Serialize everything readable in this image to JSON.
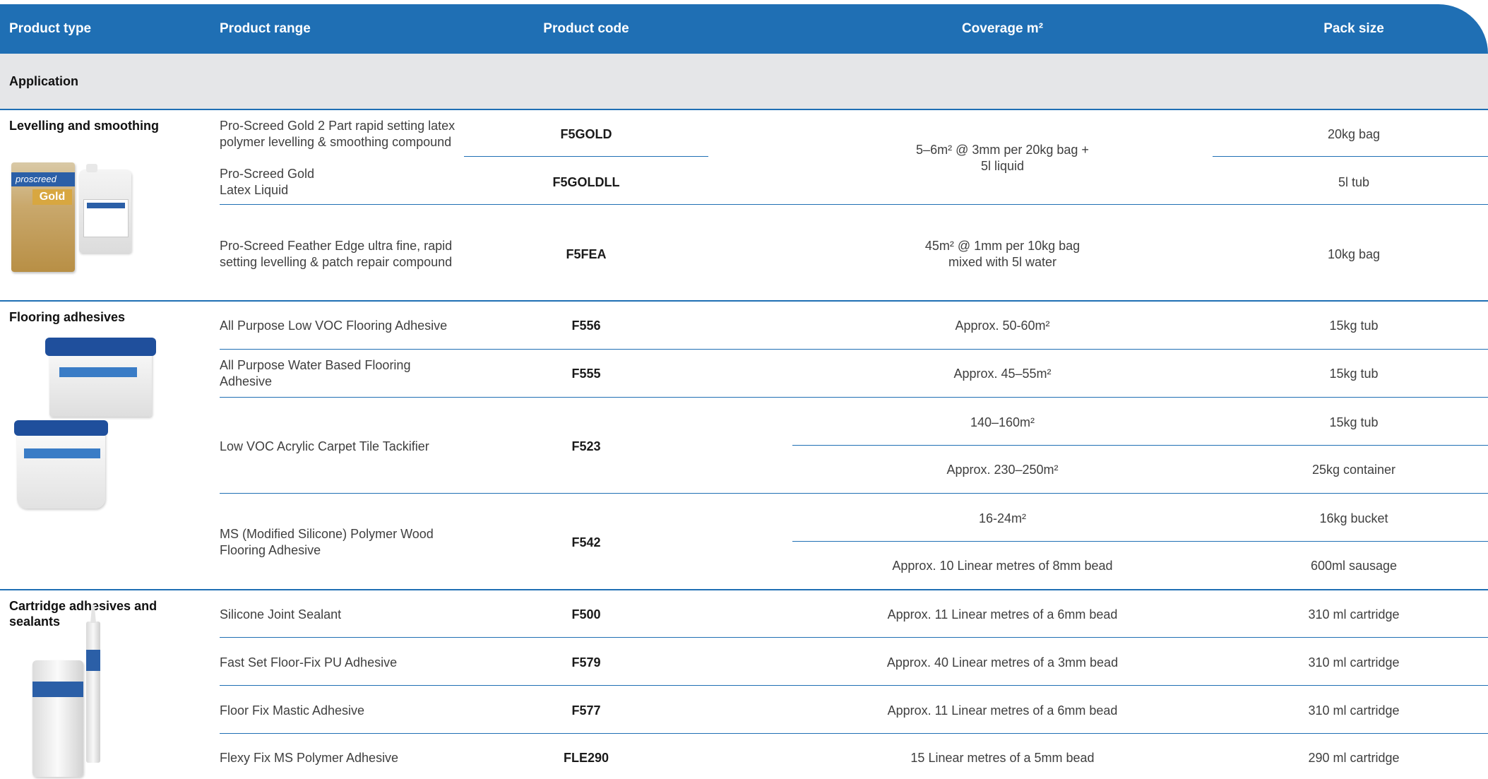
{
  "header": {
    "product_type": "Product type",
    "product_range": "Product range",
    "product_code": "Product code",
    "coverage": "Coverage m²",
    "pack_size": "Pack size"
  },
  "application_label": "Application",
  "groups": [
    {
      "title": "Levelling and smoothing",
      "rows": [
        {
          "range": "Pro-Screed Gold 2 Part rapid setting latex polymer levelling & smoothing compound",
          "code": "F5GOLD",
          "pack": "20kg bag"
        },
        {
          "range": "Pro-Screed Gold Latex Liquid",
          "code": "F5GOLDLL",
          "pack": "5l tub"
        },
        {
          "range": "Pro-Screed Feather Edge ultra fine, rapid setting levelling & patch repair compound",
          "code": "F5FEA",
          "coverage": "45m² @ 1mm per 10kg bag mixed with 5l water",
          "pack": "10kg bag"
        }
      ],
      "shared_coverage": "5–6m² @ 3mm per 20kg bag + 5l liquid"
    },
    {
      "title": "Flooring adhesives",
      "rows": [
        {
          "range": "All Purpose Low VOC Flooring Adhesive",
          "code": "F556",
          "coverage": "Approx. 50-60m²",
          "pack": "15kg tub"
        },
        {
          "range": "All Purpose Water Based Flooring Adhesive",
          "code": "F555",
          "coverage": "Approx. 45–55m²",
          "pack": "15kg tub"
        },
        {
          "range": "Low VOC Acrylic Carpet Tile Tackifier",
          "code": "F523",
          "coverage": [
            "140–160m²",
            "Approx. 230–250m²"
          ],
          "pack": [
            "15kg tub",
            "25kg container"
          ]
        },
        {
          "range": "MS (Modified Silicone) Polymer Wood Flooring Adhesive",
          "code": "F542",
          "coverage": [
            "16-24m²",
            "Approx. 10 Linear metres of 8mm bead"
          ],
          "pack": [
            "16kg bucket",
            "600ml sausage"
          ]
        }
      ]
    },
    {
      "title": "Cartridge adhesives and sealants",
      "rows": [
        {
          "range": "Silicone Joint Sealant",
          "code": "F500",
          "coverage": "Approx. 11 Linear metres of a 6mm bead",
          "pack": "310 ml cartridge"
        },
        {
          "range": "Fast Set Floor-Fix PU Adhesive",
          "code": "F579",
          "coverage": "Approx. 40 Linear metres of a 3mm bead",
          "pack": "310 ml cartridge"
        },
        {
          "range": "Floor Fix Mastic Adhesive",
          "code": "F577",
          "coverage": "Approx. 11 Linear metres of a 6mm bead",
          "pack": "310 ml cartridge"
        },
        {
          "range": "Flexy Fix MS Polymer Adhesive",
          "code": "FLE290",
          "coverage": "15 Linear metres of a 5mm bead",
          "pack": "290 ml cartridge"
        }
      ]
    }
  ],
  "product_images": {
    "levelling": [
      "screed-bag-icon",
      "latex-container-icon"
    ],
    "bag_label": "proscreed",
    "bag_gold": "Gold",
    "flooring": [
      "tackifier-tub-icon",
      "adhesive-tub-icon"
    ],
    "cartridge": [
      "adhesive-can-icon",
      "cartridge-tube-icon"
    ]
  },
  "colors": {
    "header_blue": "#1f6fb4",
    "band_grey": "#e5e6e8"
  }
}
